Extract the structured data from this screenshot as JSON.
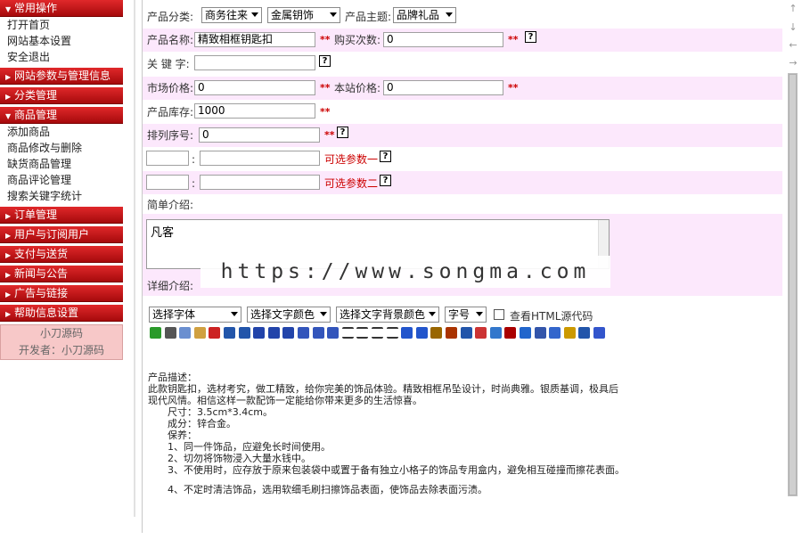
{
  "sidebar": {
    "sections": [
      {
        "title": "常用操作",
        "expanded": true,
        "items": [
          "打开首页",
          "网站基本设置",
          "安全退出"
        ]
      },
      {
        "title": "网站参数与管理信息",
        "expanded": false,
        "items": []
      },
      {
        "title": "分类管理",
        "expanded": false,
        "items": []
      },
      {
        "title": "商品管理",
        "expanded": true,
        "items": [
          "添加商品",
          "商品修改与删除",
          "缺货商品管理",
          "商品评论管理",
          "搜索关键字统计"
        ]
      },
      {
        "title": "订单管理",
        "expanded": false,
        "items": []
      },
      {
        "title": "用户与订阅用户",
        "expanded": false,
        "items": []
      },
      {
        "title": "支付与送货",
        "expanded": false,
        "items": []
      },
      {
        "title": "新闻与公告",
        "expanded": false,
        "items": []
      },
      {
        "title": "广告与链接",
        "expanded": false,
        "items": []
      },
      {
        "title": "帮助信息设置",
        "expanded": false,
        "items": []
      }
    ],
    "footer_name": "小刀源码",
    "footer_dev": "开发者：小刀源码"
  },
  "form": {
    "category_label": "产品分类:",
    "category1_value": "商务往来",
    "category2_value": "金属钥饰",
    "theme_label": "产品主题:",
    "theme_value": "品牌礼品",
    "name_label": "产品名称:",
    "name_value": "精致相框钥匙扣",
    "buy_count_label": "购买次数:",
    "buy_count_value": "0",
    "keyword_label": "关 键 字:",
    "keyword_value": "",
    "market_price_label": "市场价格:",
    "market_price_value": "0",
    "site_price_label": "本站价格:",
    "site_price_value": "0",
    "stock_label": "产品库存:",
    "stock_value": "1000",
    "sort_label": "排列序号:",
    "sort_value": "0",
    "optional1_label": "可选参数一",
    "optional2_label": "可选参数二",
    "colon": ":",
    "required_mark": "**",
    "help_mark": "?",
    "summary_label": "简单介绍:",
    "summary_value": "凡客",
    "detail_label": "详细介绍:"
  },
  "editor": {
    "font_select": "选择字体",
    "text_color_select": "选择文字颜色",
    "bg_color_select": "选择文字背景颜色",
    "size_select": "字号",
    "html_source_label": "查看HTML源代码",
    "toolbar_icons": [
      "insert-table-icon",
      "cut-icon",
      "copy-icon",
      "paste-icon",
      "delete-icon",
      "undo-icon",
      "redo-icon",
      "bold-icon",
      "italic-icon",
      "underline-icon",
      "align-left-icon",
      "align-center-icon",
      "align-right-icon",
      "ordered-list-icon",
      "unordered-list-icon",
      "outdent-icon",
      "indent-icon",
      "hr-icon",
      "hr2-icon",
      "link-icon",
      "unlink-icon",
      "image-icon",
      "flash-icon",
      "media-icon",
      "special-char-icon",
      "web-icon",
      "table-icon",
      "color-icon",
      "play-icon",
      "emoticon-icon",
      "help-icon"
    ],
    "content": [
      "产品描述：",
      "此款钥匙扣，选材考究，做工精致，给你完美的饰品体验。精致相框吊坠设计，时尚典雅。银质基调，极具后",
      "现代风情。相信这样一款配饰一定能给你带来更多的生活惊喜。",
      "尺寸：3.5cm*3.4cm。",
      "成分：锌合金。",
      "保养：",
      "1、同一件饰品，应避免长时间使用。",
      "2、切勿将饰物浸入大量水钱中。",
      "3、不使用时，应存放于原来包装袋中或置于备有独立小格子的饰品专用盒内，避免相互碰撞而擦花表面。",
      "4、不定时清洁饰品，选用软细毛刷扫擦饰品表面，使饰品去除表面污渍。"
    ]
  },
  "watermark": "https://www.songma.com"
}
